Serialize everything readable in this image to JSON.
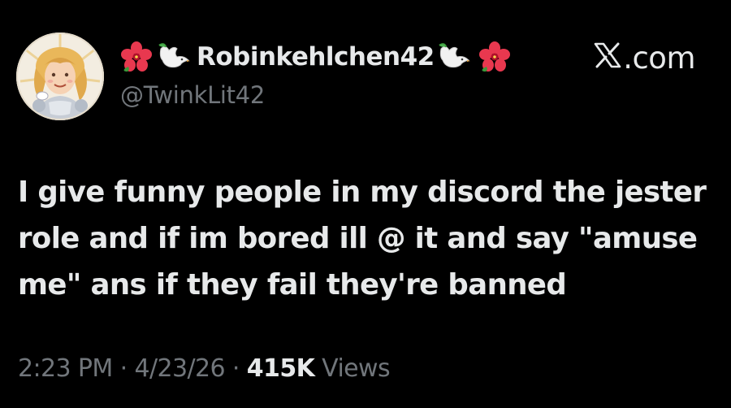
{
  "user": {
    "display_name": "Robinkehlchen42",
    "handle": "@TwinkLit42",
    "name_emojis_left": [
      "hibiscus-emoji",
      "dove-emoji"
    ],
    "name_emojis_right": [
      "dove-emoji",
      "hibiscus-emoji"
    ]
  },
  "brand": {
    "label": ".com",
    "logo": "x-logo-icon"
  },
  "tweet": {
    "text": "I give funny people in my discord the jester role and if im bored ill @ it and say \"amuse me\" ans if they fail they're banned"
  },
  "meta": {
    "time": "2:23 PM",
    "sep1": " · ",
    "date": "4/23/26",
    "sep2": " · ",
    "views_count": "415K",
    "views_label": " Views"
  },
  "colors": {
    "background": "#000000",
    "text": "#e7e9ea",
    "secondary": "#71767b"
  }
}
